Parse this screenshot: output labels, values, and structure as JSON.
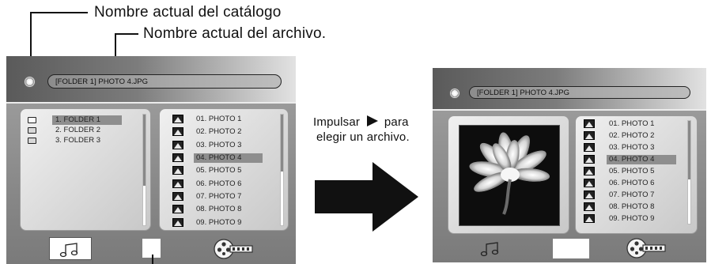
{
  "annotations": {
    "catalog_name": "Nombre actual del catálogo",
    "file_name": "Nombre actual del archivo.",
    "press_line1_before": "Impulsar",
    "press_line1_after": "para",
    "press_line2": "elegir un archivo."
  },
  "left_screen": {
    "path": "[FOLDER 1] PHOTO 4.JPG",
    "folders": [
      "1. FOLDER 1",
      "2. FOLDER 2",
      "3. FOLDER 3"
    ],
    "selected_folder_index": 0,
    "photos": [
      "01. PHOTO 1",
      "02. PHOTO 2",
      "03. PHOTO 3",
      "04. PHOTO 4",
      "05. PHOTO 5",
      "06. PHOTO 6",
      "07. PHOTO 7",
      "08. PHOTO 8",
      "09. PHOTO 9"
    ],
    "selected_photo_index": 3,
    "bottom_icons": [
      "music-icon",
      "photo-mode-icon",
      "movie-icon"
    ]
  },
  "right_screen": {
    "path": "[FOLDER 1] PHOTO 4.JPG",
    "preview_subject": "white-flower-preview",
    "photos": [
      "01. PHOTO 1",
      "02. PHOTO 2",
      "03. PHOTO 3",
      "04. PHOTO 4",
      "05. PHOTO 5",
      "06. PHOTO 6",
      "07. PHOTO 7",
      "08. PHOTO 8",
      "09. PHOTO 9"
    ],
    "selected_photo_index": 3,
    "bottom_icons": [
      "music-icon",
      "photo-mode-icon",
      "movie-icon"
    ]
  },
  "arrow": "right-arrow-icon"
}
